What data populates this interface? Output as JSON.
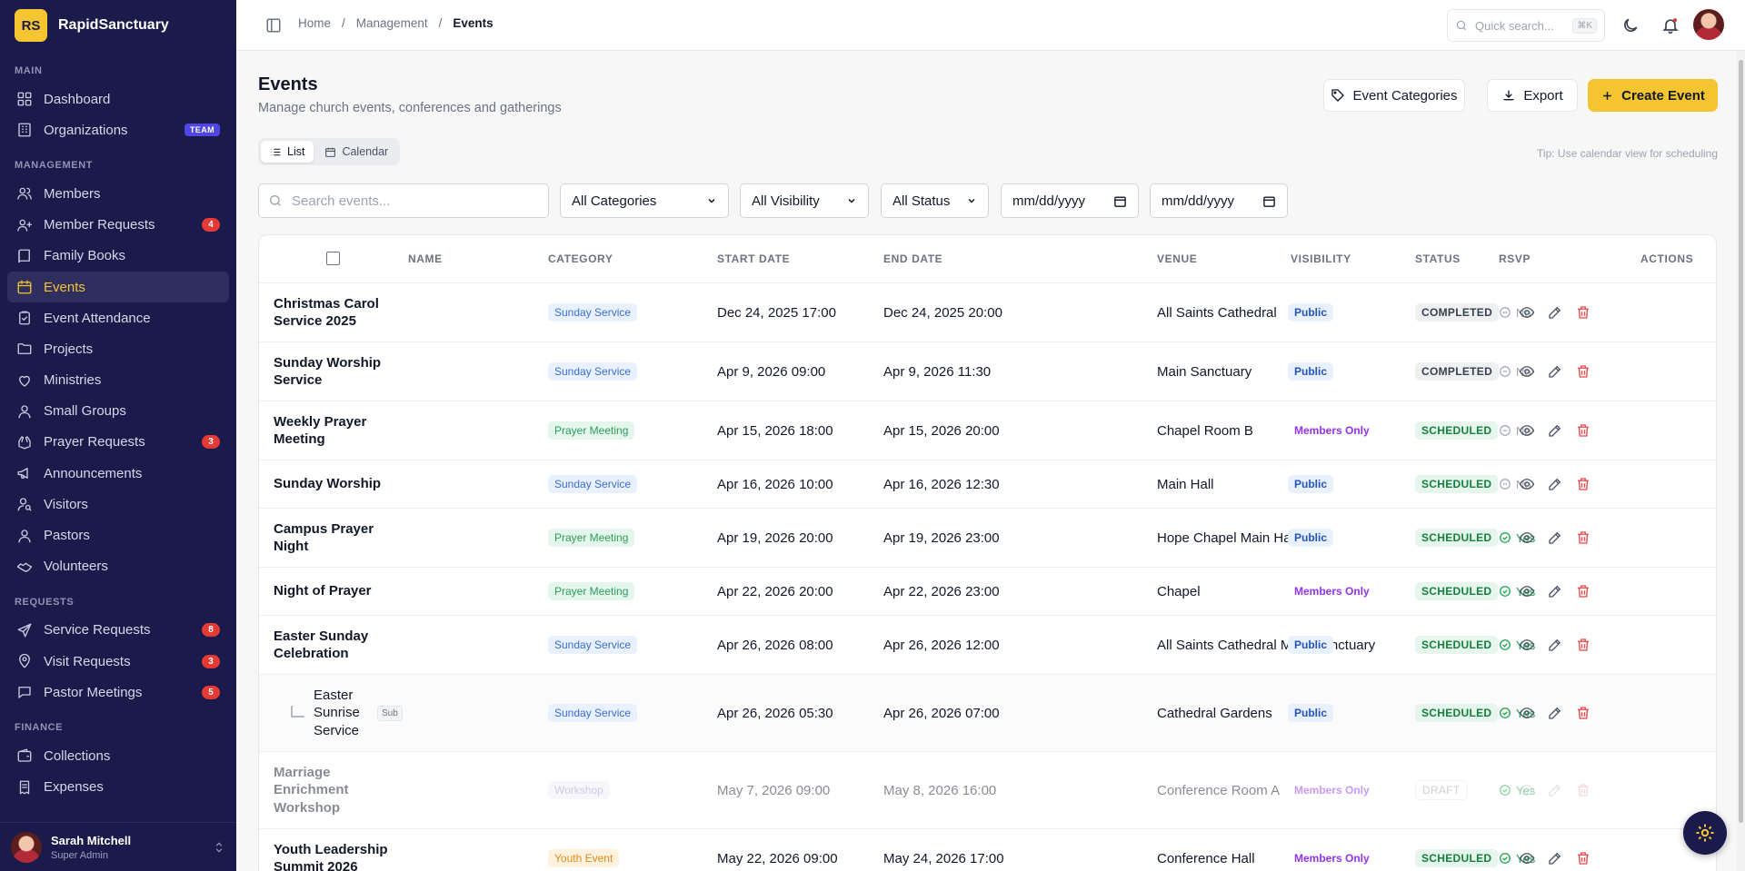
{
  "app": {
    "logo": "RS",
    "name": "RapidSanctuary"
  },
  "sidebar": {
    "sections": [
      {
        "title": "MAIN",
        "items": [
          {
            "label": "Dashboard",
            "icon": "dashboard-icon"
          },
          {
            "label": "Organizations",
            "icon": "building-icon",
            "tag": "TEAM"
          }
        ]
      },
      {
        "title": "MANAGEMENT",
        "items": [
          {
            "label": "Members",
            "icon": "users-icon"
          },
          {
            "label": "Member Requests",
            "icon": "user-plus-icon",
            "badge": "4"
          },
          {
            "label": "Family Books",
            "icon": "book-icon"
          },
          {
            "label": "Events",
            "icon": "calendar-icon",
            "active": true
          },
          {
            "label": "Event Attendance",
            "icon": "clipboard-check-icon"
          },
          {
            "label": "Projects",
            "icon": "folder-icon"
          },
          {
            "label": "Ministries",
            "icon": "heart-icon"
          },
          {
            "label": "Small Groups",
            "icon": "group-icon"
          },
          {
            "label": "Prayer Requests",
            "icon": "hands-icon",
            "badge": "3"
          },
          {
            "label": "Announcements",
            "icon": "megaphone-icon"
          },
          {
            "label": "Visitors",
            "icon": "user-search-icon"
          },
          {
            "label": "Pastors",
            "icon": "user-icon"
          },
          {
            "label": "Volunteers",
            "icon": "handshake-icon"
          }
        ]
      },
      {
        "title": "REQUESTS",
        "items": [
          {
            "label": "Service Requests",
            "icon": "send-icon",
            "badge": "8"
          },
          {
            "label": "Visit Requests",
            "icon": "map-pin-icon",
            "badge": "3"
          },
          {
            "label": "Pastor Meetings",
            "icon": "chat-icon",
            "badge": "5"
          }
        ]
      },
      {
        "title": "FINANCE",
        "items": [
          {
            "label": "Collections",
            "icon": "wallet-icon"
          },
          {
            "label": "Expenses",
            "icon": "receipt-icon"
          }
        ]
      }
    ],
    "user": {
      "name": "Sarah Mitchell",
      "role": "Super Admin"
    }
  },
  "topbar": {
    "breadcrumb": [
      "Home",
      "Management",
      "Events"
    ],
    "search_placeholder": "Quick search...",
    "shortcut": "⌘K"
  },
  "page": {
    "title": "Events",
    "subtitle": "Manage church events, conferences and gatherings",
    "buttons": {
      "categories": "Event Categories",
      "export": "Export",
      "create": "Create Event"
    },
    "views": {
      "list": "List",
      "calendar": "Calendar"
    },
    "tip": "Tip: Use calendar view for scheduling"
  },
  "filters": {
    "search_placeholder": "Search events...",
    "category": "All Categories",
    "visibility": "All Visibility",
    "status": "All Status",
    "date_from": "mm/dd/yyyy",
    "date_to": "mm/dd/yyyy"
  },
  "table": {
    "columns": [
      "NAME",
      "CATEGORY",
      "START DATE",
      "END DATE",
      "VENUE",
      "VISIBILITY",
      "STATUS",
      "RSVP",
      "ACTIONS"
    ],
    "rows": [
      {
        "name": "Christmas Carol Service 2025",
        "category": "Sunday Service",
        "start": "Dec 24, 2025 17:00",
        "end": "Dec 24, 2025 20:00",
        "venue": "All Saints Cathedral",
        "visibility": "Public",
        "status": "COMPLETED",
        "rsvp": "No"
      },
      {
        "name": "Sunday Worship Service",
        "category": "Sunday Service",
        "start": "Apr 9, 2026 09:00",
        "end": "Apr 9, 2026 11:30",
        "venue": "Main Sanctuary",
        "visibility": "Public",
        "status": "COMPLETED",
        "rsvp": "No"
      },
      {
        "name": "Weekly Prayer Meeting",
        "category": "Prayer Meeting",
        "start": "Apr 15, 2026 18:00",
        "end": "Apr 15, 2026 20:00",
        "venue": "Chapel Room B",
        "visibility": "Members Only",
        "status": "SCHEDULED",
        "rsvp": "No"
      },
      {
        "name": "Sunday Worship",
        "category": "Sunday Service",
        "start": "Apr 16, 2026 10:00",
        "end": "Apr 16, 2026 12:30",
        "venue": "Main Hall",
        "visibility": "Public",
        "status": "SCHEDULED",
        "rsvp": "No"
      },
      {
        "name": "Campus Prayer Night",
        "category": "Prayer Meeting",
        "start": "Apr 19, 2026 20:00",
        "end": "Apr 19, 2026 23:00",
        "venue": "Hope Chapel Main Hall",
        "visibility": "Public",
        "status": "SCHEDULED",
        "rsvp": "Yes"
      },
      {
        "name": "Night of Prayer",
        "category": "Prayer Meeting",
        "start": "Apr 22, 2026 20:00",
        "end": "Apr 22, 2026 23:00",
        "venue": "Chapel",
        "visibility": "Members Only",
        "status": "SCHEDULED",
        "rsvp": "Yes"
      },
      {
        "name": "Easter Sunday Celebration",
        "category": "Sunday Service",
        "start": "Apr 26, 2026 08:00",
        "end": "Apr 26, 2026 12:00",
        "venue": "All Saints Cathedral Main Sanctuary",
        "visibility": "Public",
        "status": "SCHEDULED",
        "rsvp": "Yes"
      },
      {
        "name": "Easter Sunrise Service",
        "sub": "Sub",
        "category": "Sunday Service",
        "start": "Apr 26, 2026 05:30",
        "end": "Apr 26, 2026 07:00",
        "venue": "Cathedral Gardens",
        "visibility": "Public",
        "status": "SCHEDULED",
        "rsvp": "Yes"
      },
      {
        "name": "Marriage Enrichment Workshop",
        "category": "Workshop",
        "start": "May 7, 2026 09:00",
        "end": "May 8, 2026 16:00",
        "venue": "Conference Room A",
        "visibility": "Members Only",
        "status": "DRAFT",
        "rsvp": "Yes"
      },
      {
        "name": "Youth Leadership Summit 2026",
        "category": "Youth Event",
        "start": "May 22, 2026 09:00",
        "end": "May 24, 2026 17:00",
        "venue": "Conference Hall",
        "visibility": "Members Only",
        "status": "SCHEDULED",
        "rsvp": "Yes"
      }
    ]
  },
  "colors": {
    "sidebar": "#1b1b4b",
    "accent": "#f5c431",
    "badge": "#e53935",
    "delete": "#ef4444"
  }
}
